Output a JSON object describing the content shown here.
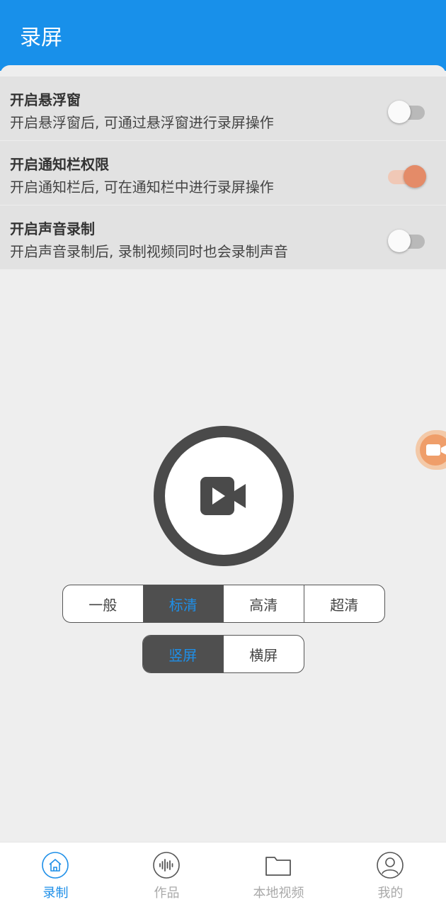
{
  "header": {
    "title": "录屏"
  },
  "settings": [
    {
      "title": "开启悬浮窗",
      "desc": "开启悬浮窗后, 可通过悬浮窗进行录屏操作",
      "enabled": false
    },
    {
      "title": "开启通知栏权限",
      "desc": "开启通知栏后, 可在通知栏中进行录屏操作",
      "enabled": true
    },
    {
      "title": "开启声音录制",
      "desc": "开启声音录制后, 录制视频同时也会录制声音",
      "enabled": false
    }
  ],
  "record_button": {
    "icon": "video-camera-play-icon"
  },
  "floating_widget": {
    "icon": "video-camera-icon"
  },
  "quality": {
    "options": [
      "一般",
      "标清",
      "高清",
      "超清"
    ],
    "selected": "标清"
  },
  "orientation": {
    "options": [
      "竖屏",
      "横屏"
    ],
    "selected": "竖屏"
  },
  "tabbar": {
    "tabs": [
      {
        "label": "录制",
        "icon": "home-icon",
        "active": true
      },
      {
        "label": "作品",
        "icon": "audio-wave-icon",
        "active": false
      },
      {
        "label": "本地视频",
        "icon": "folder-icon",
        "active": false
      },
      {
        "label": "我的",
        "icon": "user-icon",
        "active": false
      }
    ]
  },
  "colors": {
    "primary": "#1890ea",
    "accent": "#e48b68",
    "dark": "#4a4a4a"
  }
}
